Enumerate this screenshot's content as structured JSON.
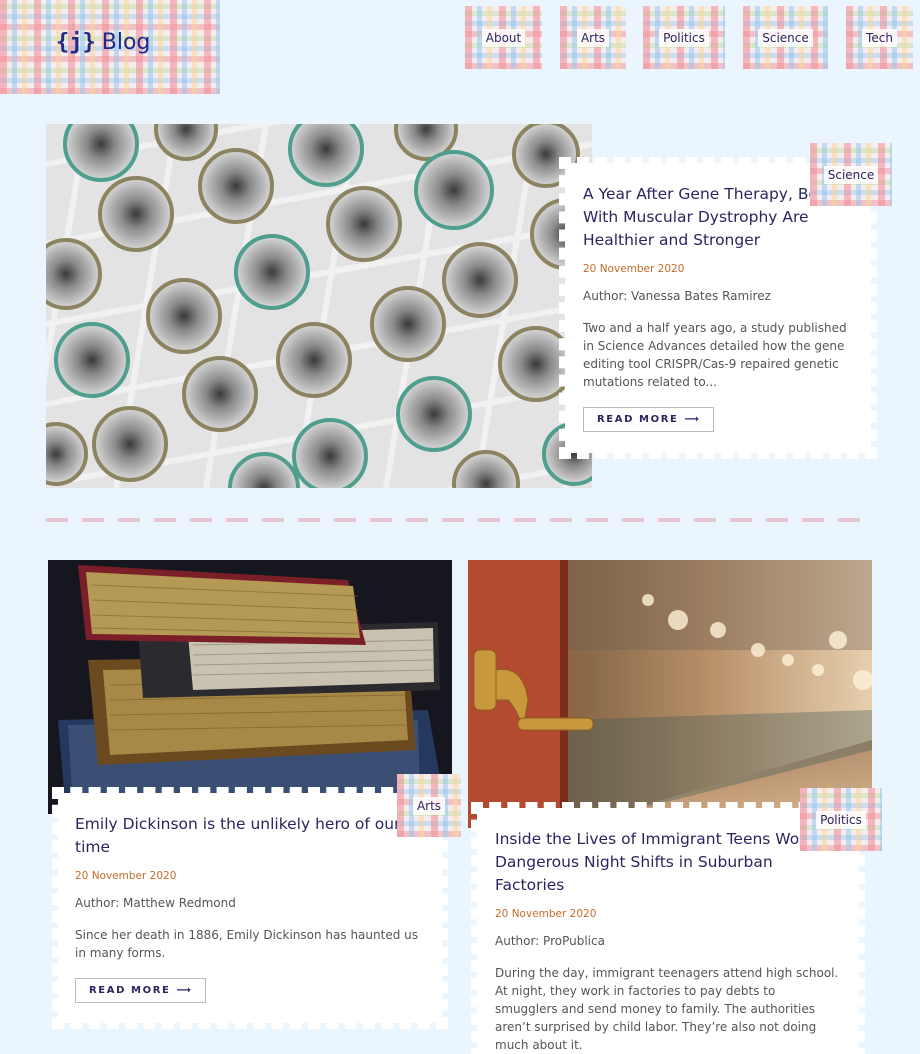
{
  "logo": {
    "mark": "{j}",
    "word": "Blog"
  },
  "nav": {
    "items": [
      "About",
      "Arts",
      "Politics",
      "Science",
      "Tech"
    ]
  },
  "featured": {
    "tag": "Science",
    "title": "A Year After Gene Therapy, Boys With Muscular Dystrophy Are Healthier and Stronger",
    "date": "20 November 2020",
    "author": "Author: Vanessa Bates Ramirez",
    "excerpt": "Two and a half years ago, a study published in Science Advances detailed how the gene editing tool CRISPR/Cas-9 repaired genetic mutations related to...",
    "read_more": "READ MORE",
    "arrow": "⟶"
  },
  "posts": [
    {
      "tag": "Arts",
      "title": "Emily Dickinson is the unlikely hero of our time",
      "date": "20 November 2020",
      "author": "Author: Matthew Redmond",
      "excerpt": "Since her death in 1886, Emily Dickinson has haunted us in many forms.",
      "read_more": "READ MORE",
      "arrow": "⟶"
    },
    {
      "tag": "Politics",
      "title": "Inside the Lives of Immigrant Teens Working Dangerous Night Shifts in Suburban Factories",
      "date": "20 November 2020",
      "author": "Author: ProPublica",
      "excerpt": "During the day, immigrant teenagers attend high school. At night, they work in factories to pay debts to smugglers and send money to family. The authorities aren’t surprised by child labor. They’re also not doing much about it."
    }
  ]
}
